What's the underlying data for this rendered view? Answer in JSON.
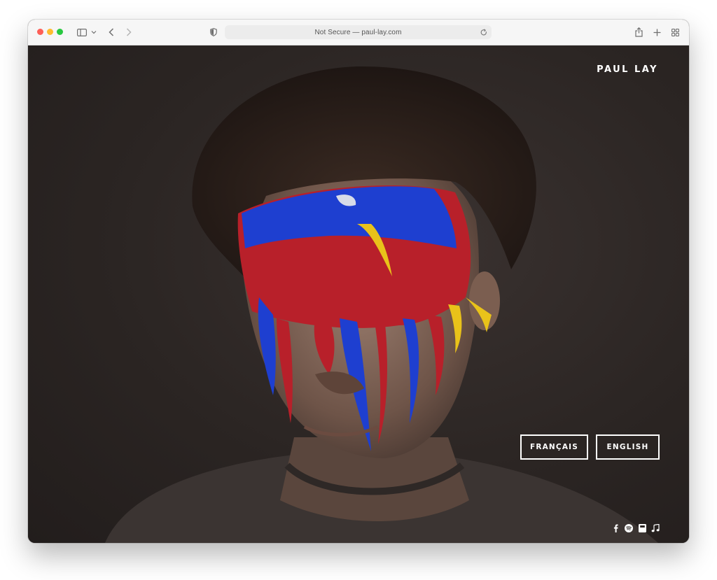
{
  "browser": {
    "address": "Not Secure — paul-lay.com",
    "icons": [
      "sidebar-icon",
      "chevron-down-icon",
      "back-icon",
      "forward-icon",
      "shield-icon",
      "reload-icon",
      "share-icon",
      "new-tab-icon",
      "tab-overview-icon"
    ]
  },
  "site": {
    "brand": "PAUL LAY",
    "languages": {
      "french": "FRANÇAIS",
      "english": "ENGLISH"
    },
    "social_icons": [
      "facebook-icon",
      "spotify-icon",
      "bandcamp-icon",
      "music-note-icon"
    ]
  },
  "colors": {
    "background": "#2a2422",
    "paint_red": "#b8202a",
    "paint_blue": "#1e3fd0",
    "paint_yellow": "#e9c21a",
    "text": "#ffffff"
  }
}
